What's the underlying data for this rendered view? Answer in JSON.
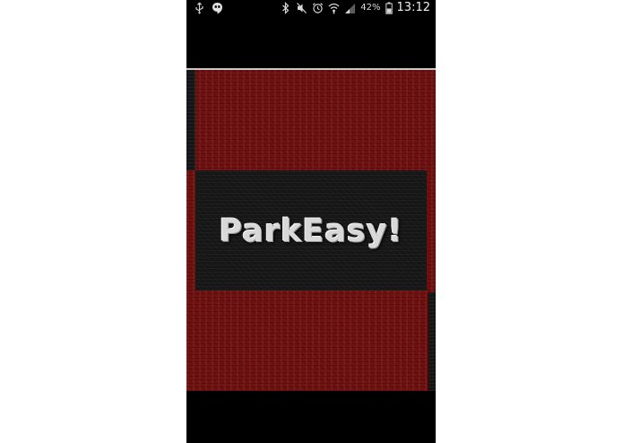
{
  "status_bar": {
    "battery_percent": "42%",
    "time": "13:12",
    "icons": [
      "usb-icon",
      "hangouts-icon",
      "bluetooth-icon",
      "mute-icon",
      "alarm-icon",
      "wifi-icon",
      "signal-icon",
      "battery-icon"
    ]
  },
  "splash": {
    "app_name": "ParkEasy!"
  },
  "colors": {
    "background": "#000000",
    "panel_red": "#6e1212",
    "logo_box": "#161616",
    "logo_text": "#d8d8d8"
  }
}
